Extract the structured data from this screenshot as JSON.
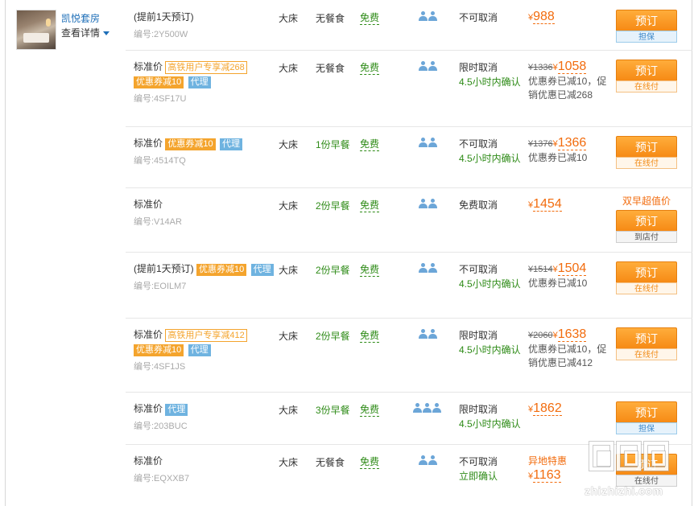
{
  "room": {
    "name": "凯悦套房",
    "detail_link": "查看详情",
    "thumb_icon": "room-photo"
  },
  "colors": {
    "accent_orange": "#f26c0e",
    "green": "#2e8b17",
    "link_blue": "#1f6fb8",
    "tag_blue": "#6fb3e0",
    "tag_orange": "#f4a42d"
  },
  "rows": [
    {
      "plan_prefix": "(提前1天预订)",
      "tags": [],
      "code": "编号:2Y500W",
      "bed": "大床",
      "meal": "无餐食",
      "meal_green": false,
      "free_label": "免费",
      "persons": 2,
      "cancel": "不可取消",
      "confirm": "",
      "orig_price": "",
      "yen": "¥",
      "price": "988",
      "price_note": "",
      "special": "",
      "book_label": "",
      "book_btn": "预订",
      "book_sub": "担保",
      "book_sub_style": "blue"
    },
    {
      "plan_prefix": "标准价",
      "tags": [
        {
          "text": "高铁用户专享减268",
          "style": "outline"
        },
        {
          "text": "优惠券减10",
          "style": "orange"
        },
        {
          "text": "代理",
          "style": "blue"
        }
      ],
      "code": "编号:4SF17U",
      "bed": "大床",
      "meal": "无餐食",
      "meal_green": false,
      "free_label": "免费",
      "persons": 2,
      "cancel": "限时取消",
      "confirm": "4.5小时内确认",
      "orig_price": "¥1336",
      "yen": "¥",
      "price": "1058",
      "price_note": "优惠券已减10，促销优惠已减268",
      "special": "",
      "book_label": "",
      "book_btn": "预订",
      "book_sub": "在线付",
      "book_sub_style": "orange"
    },
    {
      "plan_prefix": "标准价",
      "tags": [
        {
          "text": "优惠券减10",
          "style": "orange"
        },
        {
          "text": "代理",
          "style": "blue"
        }
      ],
      "code": "编号:4514TQ",
      "bed": "大床",
      "meal": "1份早餐",
      "meal_green": true,
      "free_label": "免费",
      "persons": 2,
      "cancel": "不可取消",
      "confirm": "4.5小时内确认",
      "orig_price": "¥1376",
      "yen": "¥",
      "price": "1366",
      "price_note": "优惠券已减10",
      "special": "",
      "book_label": "",
      "book_btn": "预订",
      "book_sub": "在线付",
      "book_sub_style": "orange"
    },
    {
      "plan_prefix": "标准价",
      "tags": [],
      "code": "编号:V14AR",
      "bed": "大床",
      "meal": "2份早餐",
      "meal_green": true,
      "free_label": "免费",
      "persons": 2,
      "cancel": "免费取消",
      "confirm": "",
      "orig_price": "",
      "yen": "¥",
      "price": "1454",
      "price_note": "",
      "special": "",
      "book_label": "双早超值价",
      "book_btn": "预订",
      "book_sub": "到店付",
      "book_sub_style": "gray"
    },
    {
      "plan_prefix": "(提前1天预订)",
      "tags": [
        {
          "text": "优惠券减10",
          "style": "orange"
        },
        {
          "text": "代理",
          "style": "blue"
        }
      ],
      "code": "编号:EOILM7",
      "bed": "大床",
      "meal": "2份早餐",
      "meal_green": true,
      "free_label": "免费",
      "persons": 2,
      "cancel": "不可取消",
      "confirm": "4.5小时内确认",
      "orig_price": "¥1514",
      "yen": "¥",
      "price": "1504",
      "price_note": "优惠券已减10",
      "special": "",
      "book_label": "",
      "book_btn": "预订",
      "book_sub": "在线付",
      "book_sub_style": "orange"
    },
    {
      "plan_prefix": "标准价",
      "tags": [
        {
          "text": "高铁用户专享减412",
          "style": "outline"
        },
        {
          "text": "优惠券减10",
          "style": "orange"
        },
        {
          "text": "代理",
          "style": "blue"
        }
      ],
      "code": "编号:4SF1JS",
      "bed": "大床",
      "meal": "2份早餐",
      "meal_green": true,
      "free_label": "免费",
      "persons": 2,
      "cancel": "限时取消",
      "confirm": "4.5小时内确认",
      "orig_price": "¥2060",
      "yen": "¥",
      "price": "1638",
      "price_note": "优惠券已减10，促销优惠已减412",
      "special": "",
      "book_label": "",
      "book_btn": "预订",
      "book_sub": "在线付",
      "book_sub_style": "orange"
    },
    {
      "plan_prefix": "标准价",
      "tags": [
        {
          "text": "代理",
          "style": "blue"
        }
      ],
      "code": "编号:203BUC",
      "bed": "大床",
      "meal": "3份早餐",
      "meal_green": true,
      "free_label": "免费",
      "persons": 3,
      "cancel": "限时取消",
      "confirm": "4.5小时内确认",
      "orig_price": "",
      "yen": "¥",
      "price": "1862",
      "price_note": "",
      "special": "",
      "book_label": "",
      "book_btn": "预订",
      "book_sub": "担保",
      "book_sub_style": "blue"
    },
    {
      "plan_prefix": "标准价",
      "tags": [],
      "code": "编号:EQXXB7",
      "bed": "大床",
      "meal": "无餐食",
      "meal_green": false,
      "free_label": "免费",
      "persons": 2,
      "cancel": "不可取消",
      "confirm": "立即确认",
      "orig_price": "",
      "yen": "¥",
      "price": "1163",
      "price_note": "",
      "special": "异地特惠",
      "book_label": "",
      "book_btn": "预订",
      "book_sub": "在线付",
      "book_sub_style": "gray"
    }
  ],
  "watermark": {
    "text": "zhizhizhi.com"
  }
}
